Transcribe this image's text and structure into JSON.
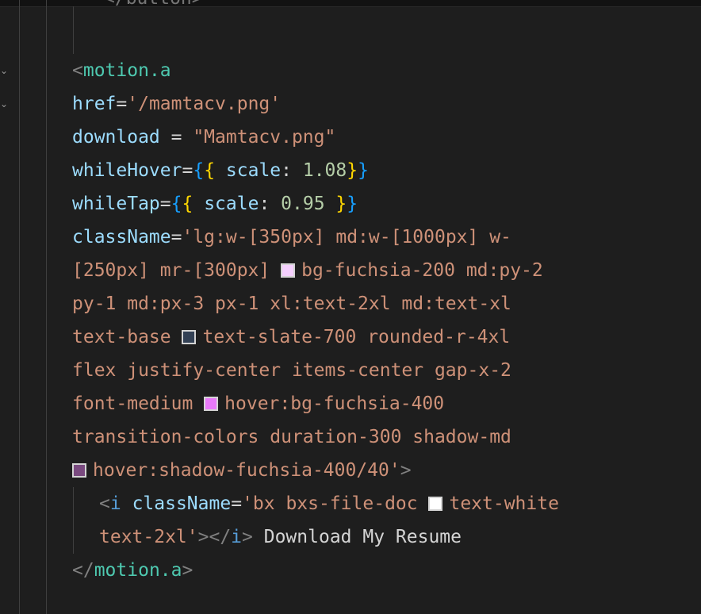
{
  "colors": {
    "fuchsia_200": "#f5d0fe",
    "slate_700": "#334155",
    "fuchsia_400": "#e879f9",
    "fuchsia_400_40": "#7a4a80",
    "white": "#ffffff"
  },
  "code": {
    "partial_top": "</button>",
    "l1_open": "<",
    "l1_tag": "motion.a",
    "l2_attr": "href",
    "l2_eq": "=",
    "l2_val": "'/mamtacv.png'",
    "l3_attr": "download",
    "l3_eq": " = ",
    "l3_val": "\"Mamtacv.png\"",
    "l4_attr": "whileHover",
    "l4_eq": "=",
    "l4_b1": "{",
    "l4_b2": "{",
    "l4_prop": " scale",
    "l4_colon": ": ",
    "l4_num": "1.08",
    "l4_b3": "}",
    "l4_b4": "}",
    "l5_attr": "whileTap",
    "l5_eq": "=",
    "l5_b1": "{",
    "l5_b2": "{",
    "l5_prop": " scale",
    "l5_colon": ": ",
    "l5_num": "0.95",
    "l5_b3": " }",
    "l5_b4": "}",
    "l6_attr": "className",
    "l6_eq": "=",
    "l6_val": "'lg:w-[350px] md:w-[1000px] w-",
    "l7_val_a": "[250px] mr-[300px] ",
    "l7_val_b": "bg-fuchsia-200 md:py-2",
    "l8_val": "py-1 md:px-3 px-1 xl:text-2xl md:text-xl",
    "l9_val_a": "text-base ",
    "l9_val_b": "text-slate-700 rounded-r-4xl",
    "l10_val": "flex justify-center items-center gap-x-2",
    "l11_val_a": "font-medium ",
    "l11_val_b": "hover:bg-fuchsia-400",
    "l12_val": "transition-colors duration-300 shadow-md",
    "l13_val": "hover:shadow-fuchsia-400/40'",
    "l13_close": ">",
    "l14_open": "<",
    "l14_tag": "i",
    "l14_attr": " className",
    "l14_eq": "=",
    "l14_val_a": "'bx bxs-file-doc ",
    "l14_val_b": "text-white",
    "l15_val": "text-2xl'",
    "l15_close1": "></",
    "l15_tag": "i",
    "l15_close2": ">",
    "l15_text": " Download My Resume",
    "l16_open": "</",
    "l16_tag": "motion.a",
    "l16_close": ">"
  }
}
